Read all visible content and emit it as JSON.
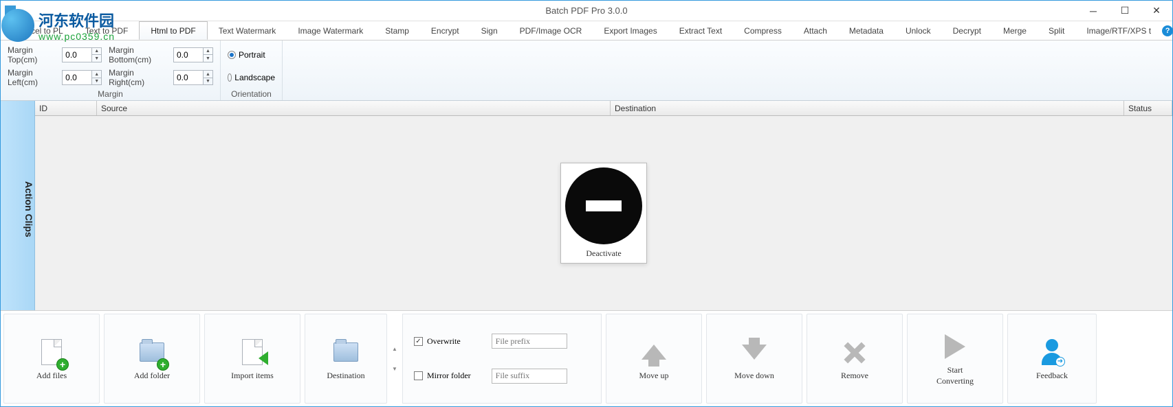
{
  "title": "Batch PDF Pro 3.0.0",
  "watermark": {
    "cn": "河东软件园",
    "url": "www.pc0359.cn"
  },
  "tabs": [
    "rd/Excel to PL",
    "Text to PDF",
    "Html to PDF",
    "Text Watermark",
    "Image Watermark",
    "Stamp",
    "Encrypt",
    "Sign",
    "PDF/Image OCR",
    "Export Images",
    "Extract Text",
    "Compress",
    "Attach",
    "Metadata",
    "Unlock",
    "Decrypt",
    "Merge",
    "Split",
    "Image/RTF/XPS t"
  ],
  "ribbon": {
    "margin_group": "Margin",
    "orient_group": "Orientation",
    "margin_top_label": "Margin Top(cm)",
    "margin_bottom_label": "Margin Bottom(cm)",
    "margin_left_label": "Margin Left(cm)",
    "margin_right_label": "Margin Right(cm)",
    "margin_top": "0.0",
    "margin_bottom": "0.0",
    "margin_left": "0.0",
    "margin_right": "0.0",
    "portrait": "Portrait",
    "landscape": "Landscape"
  },
  "side_tab": "Action Clips",
  "columns": {
    "id": "ID",
    "source": "Source",
    "destination": "Destination",
    "status": "Status"
  },
  "deactivate": "Deactivate",
  "bottom": {
    "add_files": "Add files",
    "add_folder": "Add folder",
    "import_items": "Import items",
    "destination": "Destination",
    "overwrite": "Overwrite",
    "mirror_folder": "Mirror folder",
    "file_prefix_ph": "File prefix",
    "file_suffix_ph": "File suffix",
    "move_up": "Move up",
    "move_down": "Move down",
    "remove": "Remove",
    "start_converting": "Start\nConverting",
    "feedback": "Feedback"
  }
}
